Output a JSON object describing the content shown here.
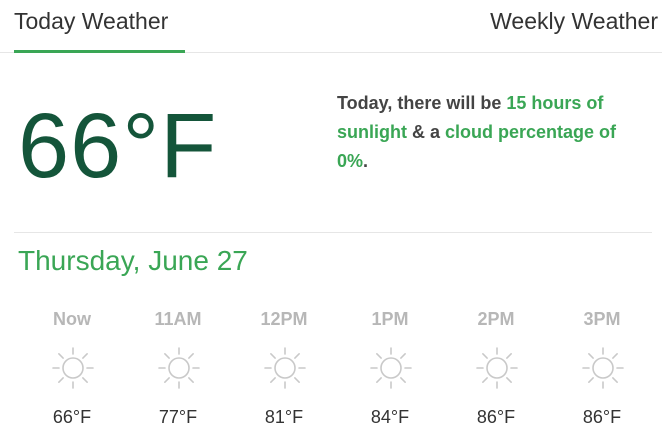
{
  "tabs": {
    "today": "Today Weather",
    "weekly": "Weekly Weather",
    "active": "today"
  },
  "current": {
    "temperature": "66°F",
    "summary": {
      "part1": "Today, there will be ",
      "sunlight": "15 hours of sunlight",
      "part2": " & a ",
      "cloud": "cloud percentage of 0%",
      "part3": "."
    }
  },
  "date": "Thursday, June 27",
  "hourly": [
    {
      "time": "Now",
      "icon": "sun-icon",
      "temp": "66°F"
    },
    {
      "time": "11AM",
      "icon": "sun-icon",
      "temp": "77°F"
    },
    {
      "time": "12PM",
      "icon": "sun-icon",
      "temp": "81°F"
    },
    {
      "time": "1PM",
      "icon": "sun-icon",
      "temp": "84°F"
    },
    {
      "time": "2PM",
      "icon": "sun-icon",
      "temp": "86°F"
    },
    {
      "time": "3PM",
      "icon": "sun-icon",
      "temp": "86°F"
    }
  ],
  "colors": {
    "accent": "#3aa655",
    "temperature": "#14553a",
    "muted": "#b7b7b7"
  }
}
